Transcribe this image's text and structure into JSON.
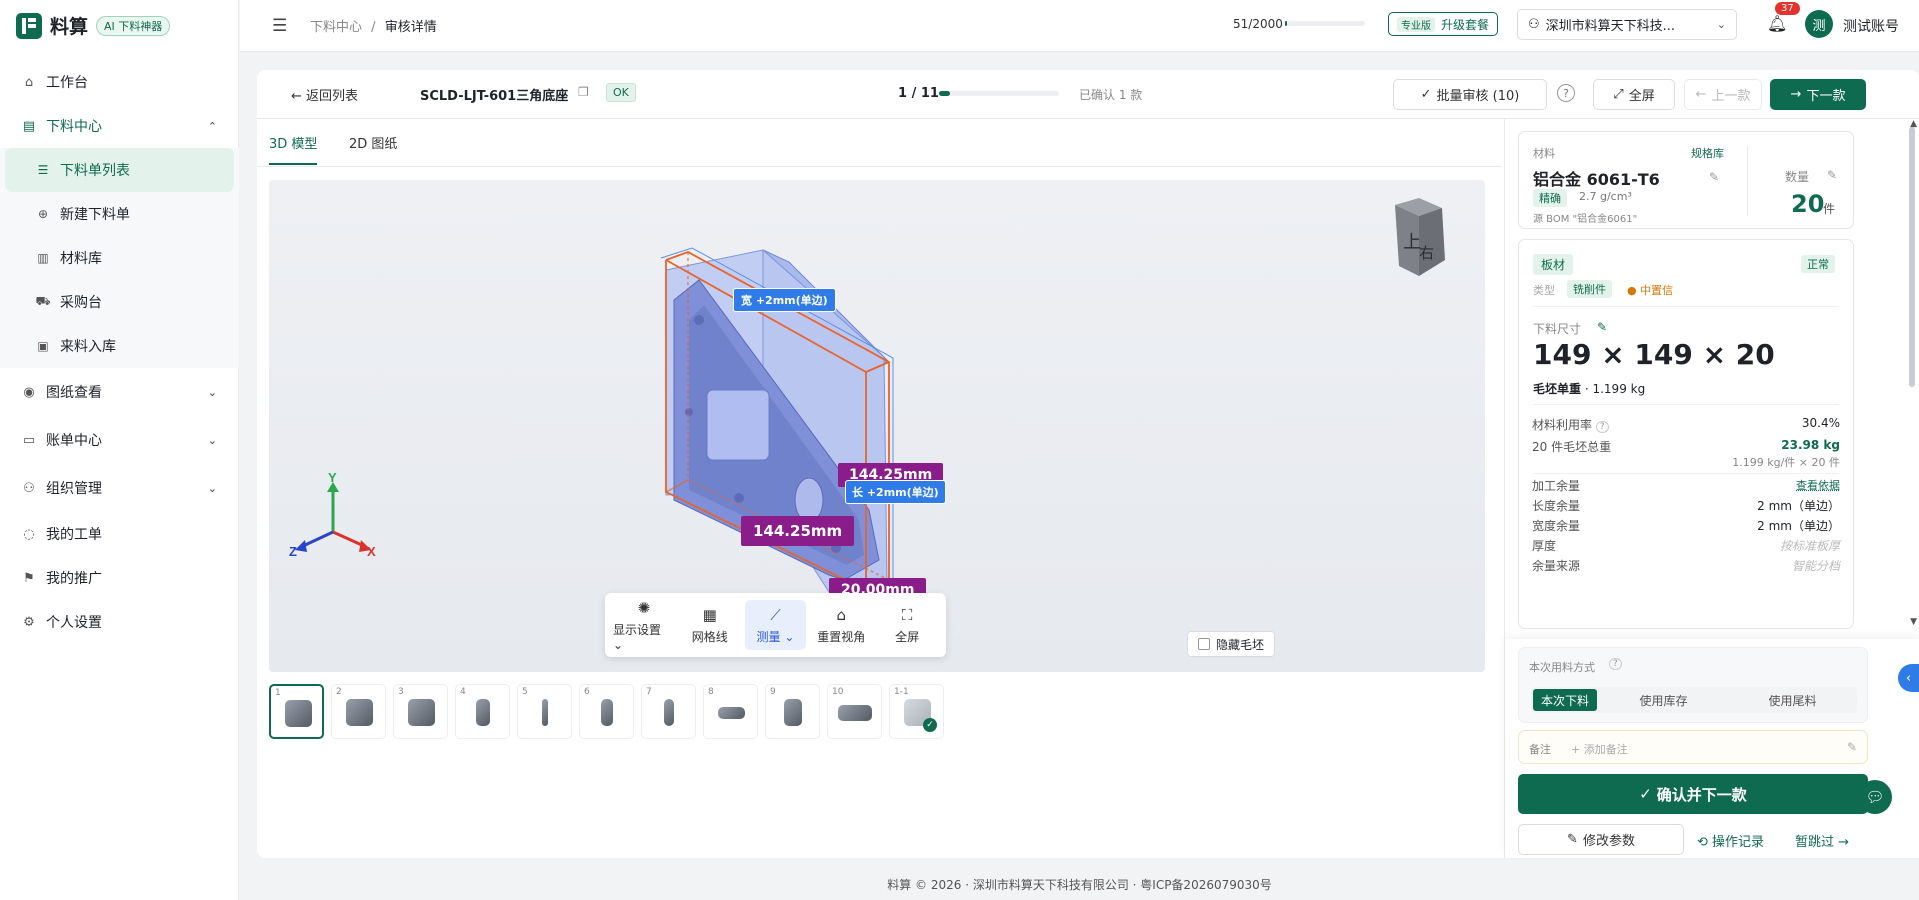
{
  "brand": {
    "name": "料算",
    "ai_badge": "AI 下料神器"
  },
  "nav": {
    "workbench": "工作台",
    "cutting_center": "下料中心",
    "cutting_subs": [
      "下料单列表",
      "新建下料单",
      "材料库",
      "采购台",
      "来料入库"
    ],
    "drawing_view": "图纸查看",
    "billing": "账单中心",
    "org": "组织管理",
    "tickets": "我的工单",
    "promo": "我的推广",
    "settings": "个人设置"
  },
  "topbar": {
    "breadcrumb_parent": "下料中心",
    "breadcrumb_sep": "/",
    "breadcrumb_current": "审核详情",
    "quota_text": "51/2000",
    "quota_fraction": 0.0255,
    "plan_tag": "专业版",
    "plan_label": "升级套餐",
    "company": "深圳市料算天下科技...",
    "notif_count": "37",
    "avatar_char": "测",
    "username": "测试账号"
  },
  "detail": {
    "back_label": "返回列表",
    "part_no": "SCLD-LJT-601三角底座",
    "status": "OK",
    "pager": "1 / 11",
    "progress_fraction": 0.09,
    "confirmed": "已确认 1 款",
    "batch_review": "批量审核 (10)",
    "fullscreen": "全屏",
    "prev": "上一款",
    "next": "下一款",
    "tabs": [
      "3D 模型",
      "2D 图纸"
    ]
  },
  "viewer": {
    "dim_width_tag": "宽 +2mm(单边)",
    "dim_length_tag": "长 +2mm(单边)",
    "dim_a": "144.25mm",
    "dim_b": "144.25mm",
    "dim_c": "20.00mm",
    "axes": {
      "x": "X",
      "y": "Y",
      "z": "Z"
    },
    "cube_faces": [
      "上",
      "右"
    ],
    "toolbar": [
      {
        "label": "显示设置",
        "icon": "sun-icon"
      },
      {
        "label": "网格线",
        "icon": "grid-icon"
      },
      {
        "label": "测量",
        "icon": "ruler-icon"
      },
      {
        "label": "重置视角",
        "icon": "home-icon"
      },
      {
        "label": "全屏",
        "icon": "expand-icon"
      }
    ],
    "hide_raw": "隐藏毛坯"
  },
  "thumbs": [
    "1",
    "2",
    "3",
    "4",
    "5",
    "6",
    "7",
    "8",
    "9",
    "10",
    "1-1"
  ],
  "material": {
    "label": "材料",
    "lib_link": "规格库",
    "name": "铝合金 6061-T6",
    "precise": "精确",
    "density": "2.7 g/cm³",
    "source": "源 BOM \"铝合金6061\"",
    "qty_label": "数量",
    "qty": "20",
    "qty_unit": "件"
  },
  "plate": {
    "kind": "板材",
    "state": "正常",
    "type_label": "类型",
    "type": "铣削件",
    "confidence": "● 中置信",
    "size_label": "下料尺寸",
    "size": "149 × 149 × 20",
    "weight_label": "毛坯单重",
    "weight": "· 1.199 kg",
    "util_label": "材料利用率",
    "util": "30.4%",
    "total_label": "20 件毛坯总重",
    "total": "23.98 kg",
    "total_sub": "1.199 kg/件 × 20 件",
    "margin_label": "加工余量",
    "margin_link": "查看依据",
    "len_margin_label": "长度余量",
    "len_margin": "2 mm（单边）",
    "wid_margin_label": "宽度余量",
    "wid_margin": "2 mm（单边）",
    "thick_label": "厚度",
    "thick": "按标准板厚",
    "src_label": "余量来源",
    "src": "智能分档"
  },
  "usage": {
    "label": "本次用料方式",
    "options": [
      "本次下料",
      "使用库存",
      "使用尾料"
    ],
    "note_label": "备注",
    "note_placeholder": "+ 添加备注"
  },
  "actions": {
    "confirm_next": "确认并下一款",
    "edit": "修改参数",
    "log": "操作记录",
    "skip": "暂跳过 →"
  },
  "footer": "料算 © 2026 · 深圳市料算天下科技有限公司 · 粤ICP备2026079030号"
}
